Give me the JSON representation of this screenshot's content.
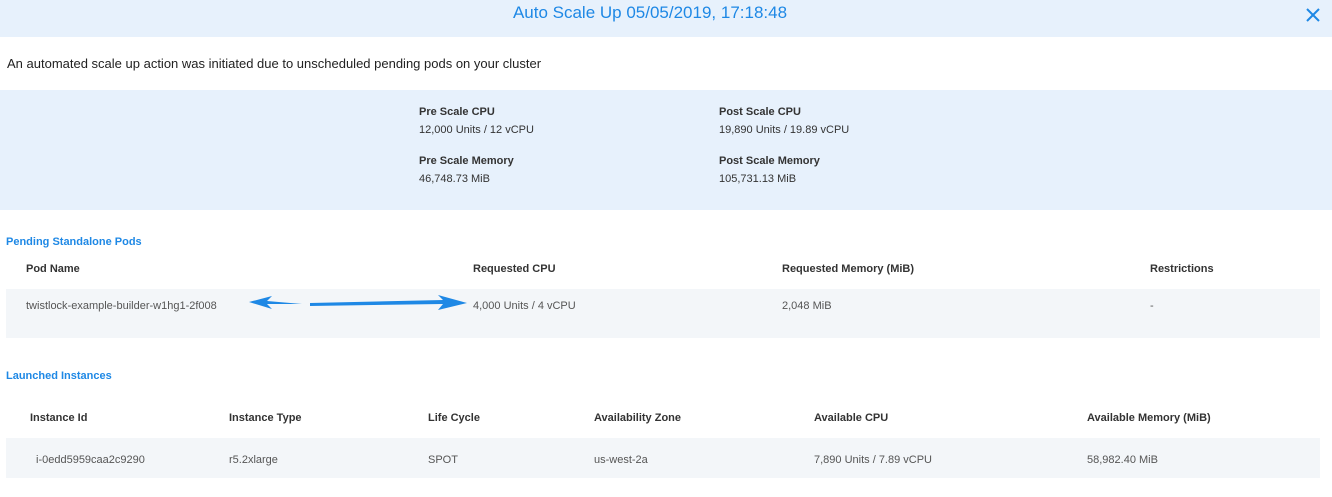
{
  "header": {
    "title": "Auto Scale Up 05/05/2019, 17:18:48",
    "close_icon": "close-icon"
  },
  "description": "An automated scale up action was initiated due to unscheduled pending pods on your cluster",
  "summary": {
    "pre_cpu_label": "Pre Scale CPU",
    "pre_cpu_value": "12,000 Units / 12 vCPU",
    "pre_memory_label": "Pre Scale Memory",
    "pre_memory_value": "46,748.73 MiB",
    "post_cpu_label": "Post Scale CPU",
    "post_cpu_value": "19,890 Units / 19.89 vCPU",
    "post_memory_label": "Post Scale Memory",
    "post_memory_value": "105,731.13 MiB"
  },
  "pending_pods": {
    "title": "Pending Standalone Pods",
    "columns": [
      "Pod Name",
      "Requested CPU",
      "Requested Memory (MiB)",
      "Restrictions"
    ],
    "rows": [
      [
        "twistlock-example-builder-w1hg1-2f008",
        "4,000 Units / 4 vCPU",
        "2,048 MiB",
        "-"
      ]
    ]
  },
  "launched_instances": {
    "title": "Launched Instances",
    "columns": [
      "Instance Id",
      "Instance Type",
      "Life Cycle",
      "Availability Zone",
      "Available CPU",
      "Available Memory (MiB)"
    ],
    "rows": [
      [
        "i-0edd5959caa2c9290",
        "r5.2xlarge",
        "SPOT",
        "us-west-2a",
        "7,890 Units / 7.89 vCPU",
        "58,982.40 MiB"
      ]
    ]
  },
  "colors": {
    "accent": "#1e88e5",
    "panel_bg": "#e7f1fc",
    "row_bg": "#f3f6f9",
    "annotation_arrow": "#1e88e5"
  }
}
